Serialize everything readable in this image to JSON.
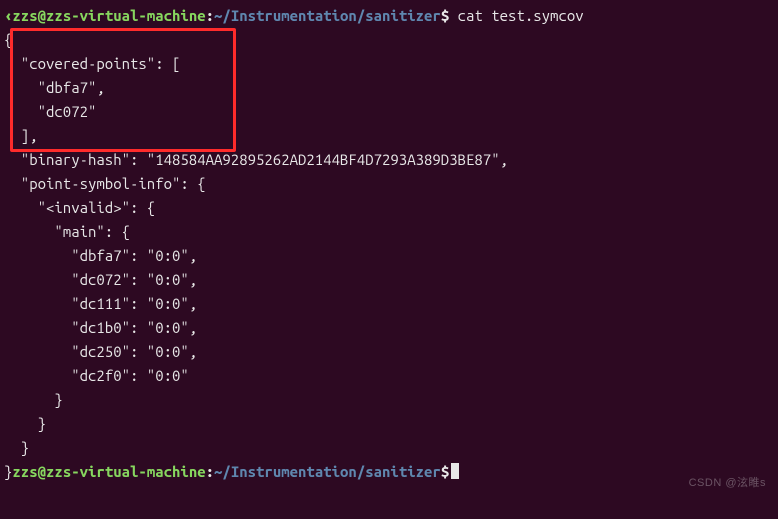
{
  "prompt1": {
    "prefix": "‹",
    "user": "zzs",
    "at": "@",
    "host": "zzs-virtual-machine",
    "colon": ":",
    "path": "~/Instrumentation/sanitizer",
    "dollar": "$",
    "cmd": " cat test.symcov"
  },
  "json_output": {
    "open": "{",
    "l_covered": "  \"covered-points\": [",
    "l_p1": "    \"dbfa7\",",
    "l_p2": "    \"dc072\"",
    "l_cov_close": "  ],",
    "l_hash": "  \"binary-hash\": \"148584AA92895262AD2144BF4D7293A389D3BE87\",",
    "l_psym": "  \"point-symbol-info\": {",
    "l_invalid": "    \"<invalid>\": {",
    "l_main": "      \"main\": {",
    "l_m1": "        \"dbfa7\": \"0:0\",",
    "l_m2": "        \"dc072\": \"0:0\",",
    "l_m3": "        \"dc111\": \"0:0\",",
    "l_m4": "        \"dc1b0\": \"0:0\",",
    "l_m5": "        \"dc250\": \"0:0\",",
    "l_m6": "        \"dc2f0\": \"0:0\"",
    "l_main_close": "      }",
    "l_invalid_close": "    }",
    "l_psym_close": "  }",
    "close_prefix": "}"
  },
  "prompt2": {
    "prefix": "}",
    "user": "zzs",
    "at": "@",
    "host": "zzs-virtual-machine",
    "colon": ":",
    "path": "~/Instrumentation/sanitizer",
    "dollar": "$"
  },
  "watermark": "CSDN @泫睢s"
}
